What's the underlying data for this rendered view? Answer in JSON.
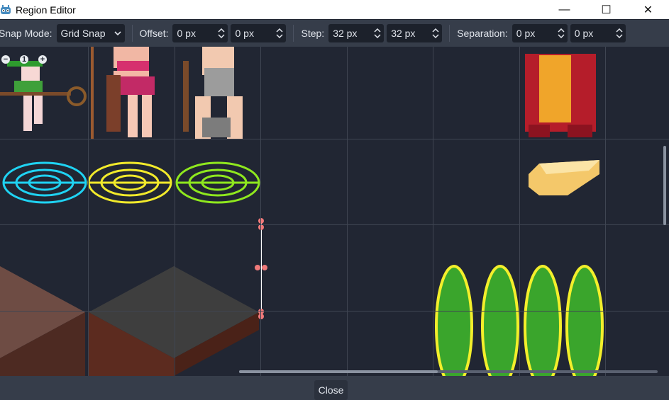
{
  "window": {
    "title": "Region Editor",
    "minimize_glyph": "—",
    "maximize_glyph": "☐",
    "close_glyph": "✕"
  },
  "toolbar": {
    "snap_mode_label": "Snap Mode:",
    "snap_mode_value": "Grid Snap",
    "offset_label": "Offset:",
    "offset_x": "0 px",
    "offset_y": "0 px",
    "step_label": "Step:",
    "step_x": "32 px",
    "step_y": "32 px",
    "separation_label": "Separation:",
    "separation_x": "0 px",
    "separation_y": "0 px"
  },
  "footer": {
    "close_label": "Close"
  },
  "icons": {
    "app": "godot-icon",
    "zoom_out": "zoom-out-icon",
    "zoom_reset": "zoom-reset-icon",
    "zoom_in": "zoom-in-icon"
  },
  "colors": {
    "background": "#202531",
    "toolbar": "#363d4a",
    "field": "#1c212b",
    "grid": "#3f4552",
    "handle": "#f07a7a",
    "cyan": "#1fd3f3",
    "yellow": "#f2ea2b",
    "lime": "#8fe81e"
  }
}
